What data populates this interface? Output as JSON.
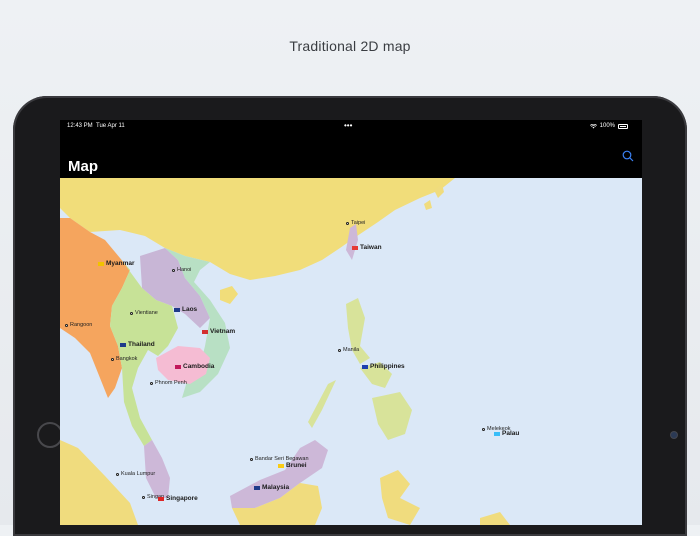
{
  "caption": "Traditional 2D map",
  "status_bar": {
    "time": "12:43 PM",
    "date": "Tue Apr 11",
    "dots": "•••",
    "battery": "100%"
  },
  "nav": {
    "title": "Map",
    "search_icon": "search-icon"
  },
  "map": {
    "countries": {
      "myanmar": "Myanmar",
      "laos": "Laos",
      "vietnam": "Vietnam",
      "thailand": "Thailand",
      "cambodia": "Cambodia",
      "philippines": "Philippines",
      "taiwan": "Taiwan",
      "palau": "Palau",
      "brunei": "Brunei",
      "malaysia": "Malaysia",
      "singapore": "Singapore"
    },
    "cities": {
      "taipei": "Taipei",
      "hanoi": "Hanoi",
      "vientiane": "Vientiane",
      "rangoon": "Rangoon",
      "bangkok": "Bangkok",
      "phnom_penh": "Phnom Penh",
      "manila": "Manila",
      "melekeok": "Melekeok",
      "bandar": "Bandar Seri Begawan",
      "kuala_lumpur": "Kuala Lumpur",
      "singapore_city": "Singap"
    }
  },
  "colors": {
    "ocean": "#dbe8f7",
    "china": "#f1dd7a",
    "myanmar": "#f5a55e",
    "laos": "#c8b6d6",
    "vietnam": "#b8e0c4",
    "thailand": "#c7e297",
    "cambodia": "#f5bcd3",
    "philippines": "#d8e39a",
    "malaysia": "#cdb8d8",
    "indonesia": "#f0dc7e"
  }
}
